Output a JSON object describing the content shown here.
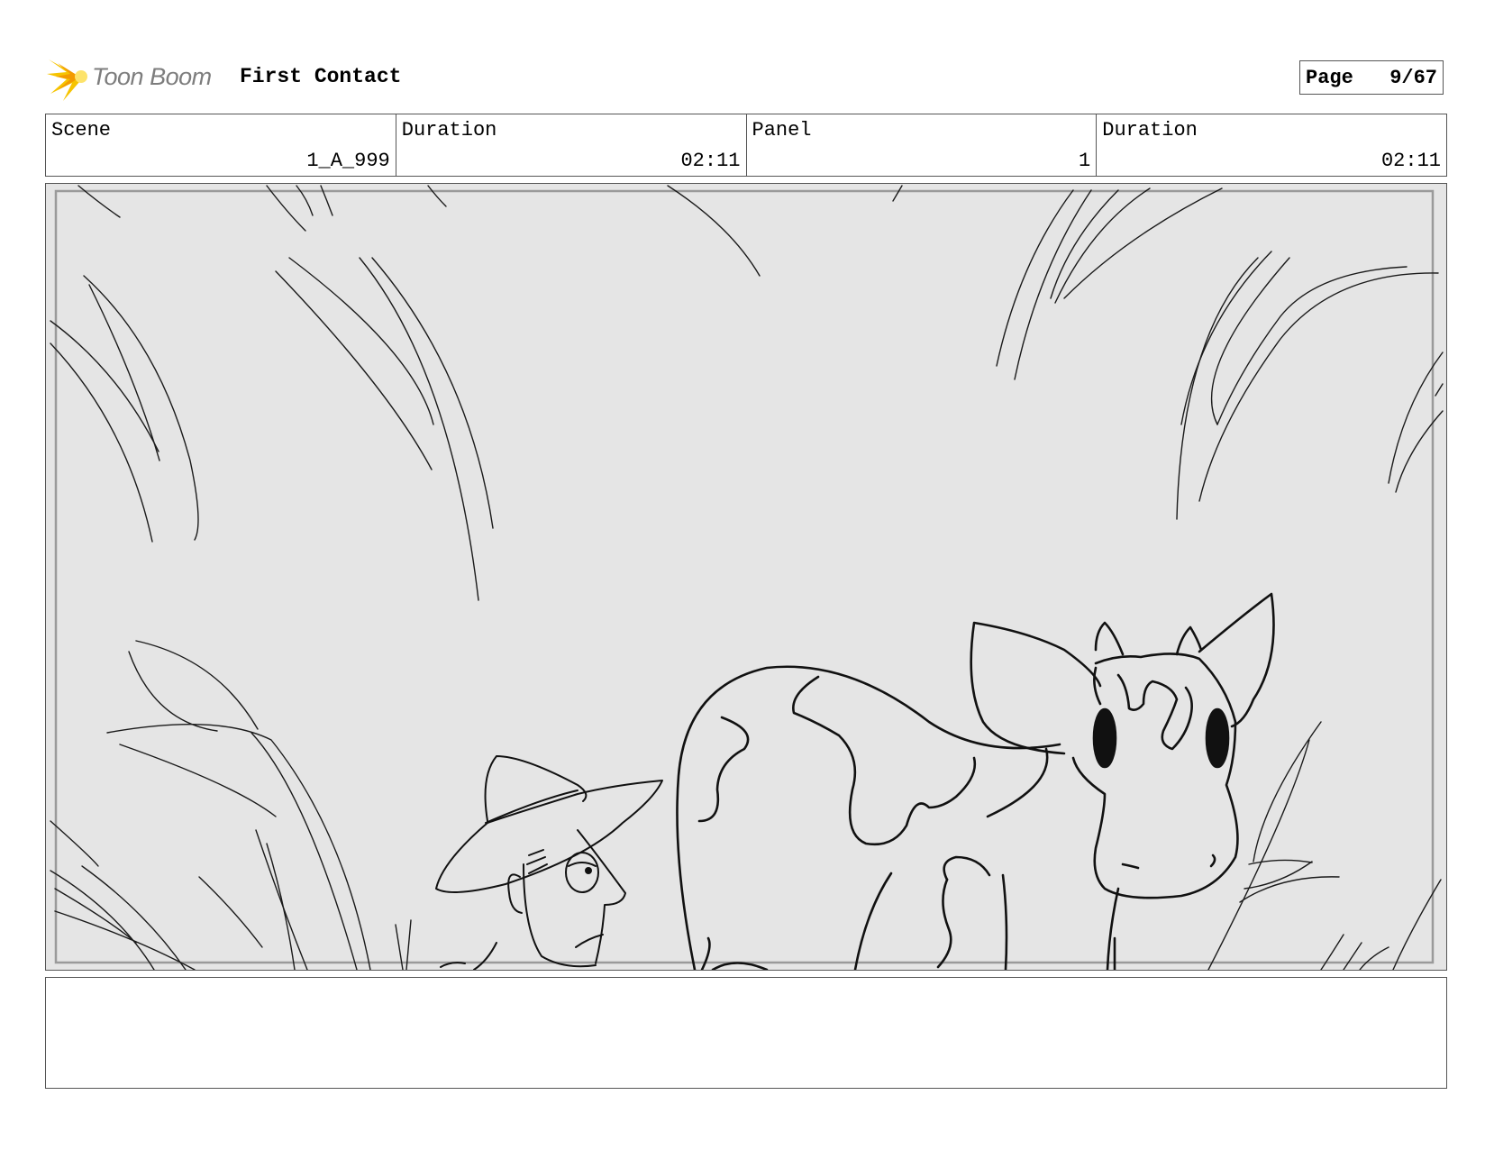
{
  "header": {
    "logo_text": "Toon Boom",
    "project_title": "First Contact",
    "page_label": "Page",
    "page_value": "9/67"
  },
  "info": {
    "scene_label": "Scene",
    "scene_value": "1_A_999",
    "scene_duration_label": "Duration",
    "scene_duration_value": "02:11",
    "panel_label": "Panel",
    "panel_value": "1",
    "panel_duration_label": "Duration",
    "panel_duration_value": "02:11"
  },
  "panel": {
    "background_color": "#e5e5e5",
    "line_color": "#111111"
  },
  "notes": {
    "text": ""
  }
}
